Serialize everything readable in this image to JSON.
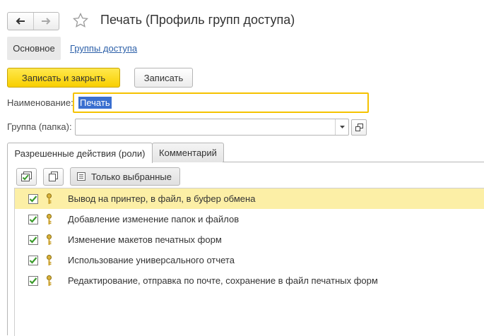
{
  "header": {
    "title": "Печать (Профиль групп доступа)",
    "back_icon": "arrow-left-icon",
    "forward_icon": "arrow-right-icon",
    "favorite_icon": "star-icon"
  },
  "sections": {
    "main": "Основное",
    "access_groups": "Группы доступа"
  },
  "toolbar": {
    "save_close_label": "Записать и закрыть",
    "save_label": "Записать"
  },
  "form": {
    "name_label": "Наименование:",
    "name_value": "Печать",
    "group_label": "Группа (папка):",
    "group_value": ""
  },
  "tabs": [
    {
      "label": "Разрешенные действия (роли)",
      "active": true
    },
    {
      "label": "Комментарий",
      "active": false
    }
  ],
  "roles_toolbar": {
    "check_all_icon": "check-all-icon",
    "copy_icon": "copy-icon",
    "only_selected_label": "Только выбранные"
  },
  "roles": [
    {
      "label": "Вывод на принтер, в файл, в буфер обмена",
      "checked": true,
      "selected": true
    },
    {
      "label": "Добавление изменение папок и файлов",
      "checked": true,
      "selected": false
    },
    {
      "label": "Изменение макетов печатных форм",
      "checked": true,
      "selected": false
    },
    {
      "label": "Использование универсального отчета",
      "checked": true,
      "selected": false
    },
    {
      "label": "Редактирование, отправка по почте, сохранение в файл печатных форм",
      "checked": true,
      "selected": false
    }
  ],
  "colors": {
    "accent_yellow": "#f8cf00",
    "selection_row": "#fcefa6",
    "link": "#2b5fa8",
    "check_green": "#3a9a2a",
    "focus_border": "#f5c200"
  }
}
